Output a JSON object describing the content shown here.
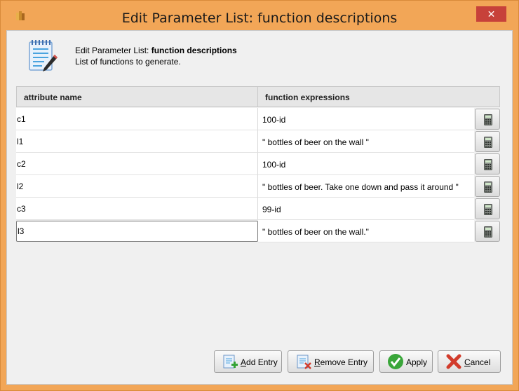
{
  "window": {
    "title": "Edit Parameter List: function descriptions",
    "close_glyph": "✕"
  },
  "header": {
    "line1_prefix": "Edit Parameter List: ",
    "line1_bold": "function descriptions",
    "line2": "List of functions to generate."
  },
  "table": {
    "columns": [
      "attribute name",
      "function expressions"
    ],
    "rows": [
      {
        "name": "c1",
        "expr": "100-id"
      },
      {
        "name": "l1",
        "expr": "\" bottles of beer on the wall \""
      },
      {
        "name": "c2",
        "expr": "100-id"
      },
      {
        "name": "l2",
        "expr": "\" bottles of beer. Take one down and pass it around \""
      },
      {
        "name": "c3",
        "expr": "99-id"
      },
      {
        "name": "l3",
        "expr": "\" bottles of beer on the wall.\""
      }
    ],
    "editing_row": 5
  },
  "buttons": {
    "add": {
      "mnemonic": "A",
      "rest": "dd Entry"
    },
    "remove": {
      "mnemonic": "R",
      "rest": "emove Entry"
    },
    "apply": {
      "label": "Apply"
    },
    "cancel": {
      "mnemonic": "C",
      "rest": "ancel"
    }
  },
  "colors": {
    "titlebar": "#f2a657",
    "close": "#c7413a",
    "apply_check": "#3aa63a",
    "cancel_x": "#d23c2c"
  }
}
